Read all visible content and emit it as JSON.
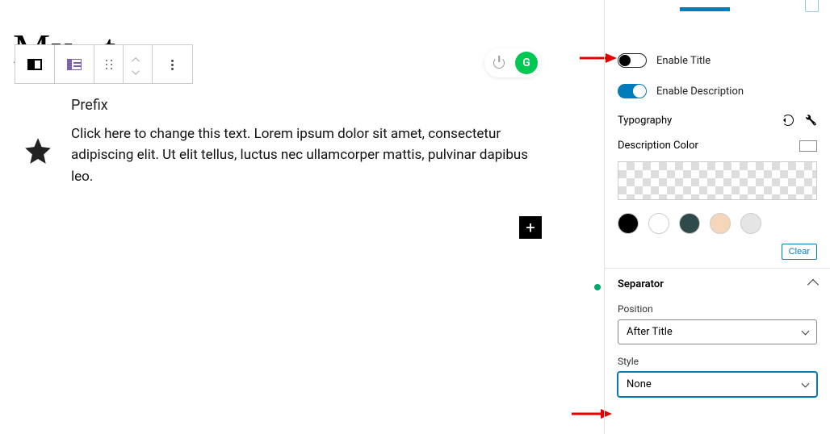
{
  "title": "My...t",
  "content": {
    "prefix": "Prefix",
    "description": "Click here to change this text. Lorem ipsum dolor sit amet, consectetur adipiscing elit. Ut elit tellus, luctus nec ullamcorper mattis, pulvinar dapibus leo."
  },
  "sidebar": {
    "enable_title": {
      "label": "Enable Title",
      "value": false
    },
    "enable_description": {
      "label": "Enable Description",
      "value": true
    },
    "typography_label": "Typography",
    "description_color_label": "Description Color",
    "colors": [
      "#000000",
      "#ffffff",
      "#2e4a4a",
      "#f5d6bb",
      "#e5e5e5"
    ],
    "clear_label": "Clear",
    "separator": {
      "heading": "Separator",
      "position_label": "Position",
      "position_value": "After Title",
      "style_label": "Style",
      "style_value": "None"
    }
  }
}
